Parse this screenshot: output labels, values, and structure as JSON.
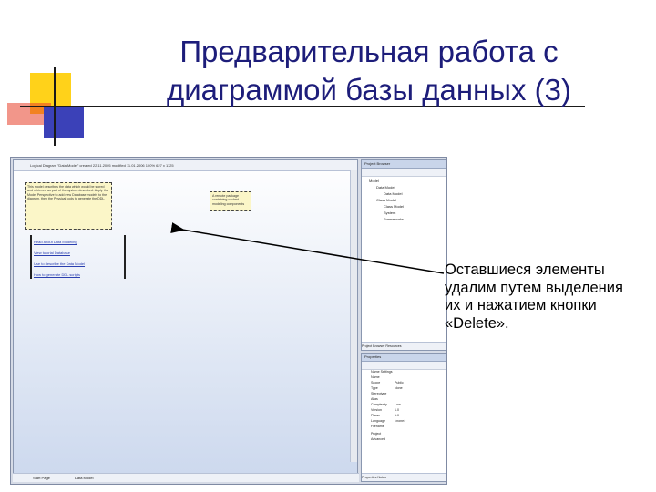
{
  "slide": {
    "title": "Предварительная работа с\nдиаграммой базы данных (3)",
    "callout": "Оставшиеся элементы\nудалим путем выделения\nих и нажатием кнопки\n«Delete».",
    "colors": {
      "title": "#1d1d7a",
      "accent_yellow": "#ffd21a",
      "accent_red": "#e8402a",
      "accent_blue": "#3b41b8"
    }
  },
  "screenshot": {
    "canvas_tab_text": "Logical Diagram \"Data Model\" created 22.11.2005 modified 11.01.2006 100% 627 x 1125",
    "note1_text": "This model describes the data which would be stored and retrieved as part of the system described. Apply the Model Perspective to add new Database models to the diagram, then the Physical tools to generate the DDL.",
    "note2_text": "A remote package containing cached modeling components",
    "links": [
      "Read about Data Modeling",
      "View tutorial Database",
      "Use to describe the Data Model",
      "How to generate DDL scripts"
    ],
    "tabs": [
      "Start Page",
      "Data Model"
    ],
    "project_browser": {
      "title": "Project Browser",
      "items": [
        "Model",
        "Data Model",
        "Data Model",
        "Class Model",
        "Class Model",
        "System",
        "Frameworks"
      ],
      "footer": "Project Browser  Resources"
    },
    "properties": {
      "title": "Properties",
      "section": "Name Settings",
      "rows": [
        {
          "k": "Name",
          "v": ""
        },
        {
          "k": "Scope",
          "v": "Public"
        },
        {
          "k": "Type",
          "v": "None"
        },
        {
          "k": "Stereotype",
          "v": ""
        },
        {
          "k": "Alias",
          "v": ""
        },
        {
          "k": "Complexity",
          "v": "Low"
        },
        {
          "k": "Version",
          "v": "1.0"
        },
        {
          "k": "Phase",
          "v": "1.0"
        },
        {
          "k": "Language",
          "v": "<none>"
        },
        {
          "k": "Filename",
          "v": ""
        }
      ],
      "groups": [
        "Project",
        "Advanced"
      ],
      "footer": "Properties  Notes"
    }
  }
}
